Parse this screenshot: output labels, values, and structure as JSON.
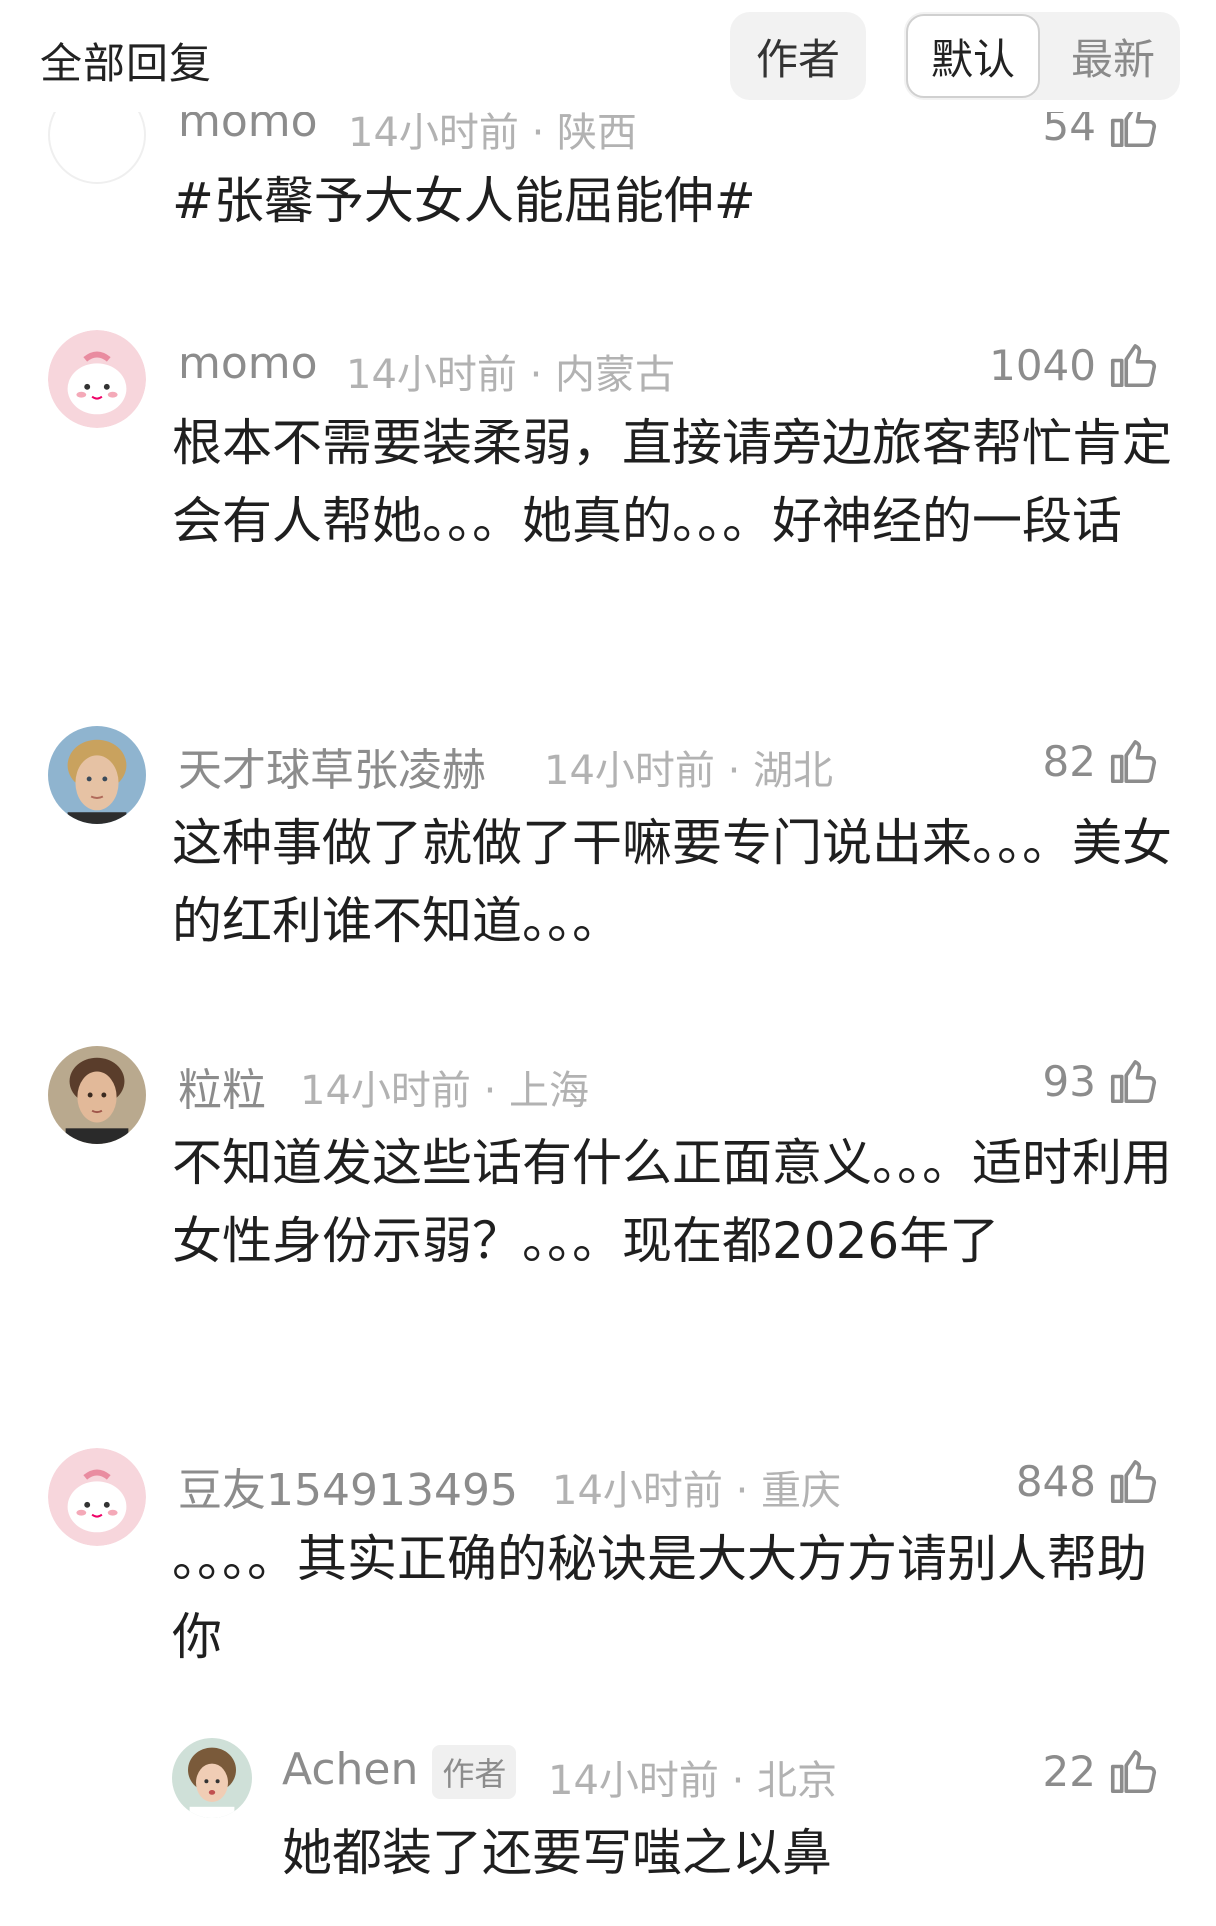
{
  "header": {
    "title": "全部回复",
    "author_filter": "作者",
    "sort_default": "默认",
    "sort_latest": "最新"
  },
  "comments": [
    {
      "name": "momo",
      "meta": "14小时前 · 陕西",
      "likes": "54",
      "body": "#张馨予大女人能屈能伸#",
      "avatar": "blank-avatar"
    },
    {
      "name": "momo",
      "meta": "14小时前 · 内蒙古",
      "likes": "1040",
      "body": "根本不需要装柔弱，直接请旁边旅客帮忙肯定会有人帮她。。。她真的。。。好神经的一段话",
      "avatar": "pink-bunny-avatar"
    },
    {
      "name": "天才球草张凌赫",
      "meta": "14小时前 · 湖北",
      "likes": "82",
      "body": "这种事做了就做了干嘛要专门说出来。。。美女的红利谁不知道。。。",
      "avatar": "photo-avatar-blond-boy"
    },
    {
      "name": "粒粒",
      "meta": "14小时前 · 上海",
      "likes": "93",
      "body": "不知道发这些话有什么正面意义。。。适时利用女性身份示弱？。。。现在都2026年了",
      "avatar": "photo-avatar-woman"
    },
    {
      "name": "豆友154913495",
      "meta": "14小时前 · 重庆",
      "likes": "848",
      "body": "。。。。其实正确的秘诀是大大方方请别人帮助你",
      "avatar": "pink-bunny-avatar"
    }
  ],
  "reply": {
    "name": "Achen",
    "badge": "作者",
    "meta": "14小时前 · 北京",
    "likes": "22",
    "body": "她都装了还要写嗤之以鼻",
    "avatar": "photo-avatar-girl"
  },
  "icons": {
    "like": "thumbs-up-icon"
  },
  "colors": {
    "name_gray": "#8c8c8c",
    "meta_gray": "#b2b2b2",
    "text": "#1f1f1f",
    "pill_bg": "#f2f2f2",
    "avatar_pink": "#f7d6dc"
  }
}
